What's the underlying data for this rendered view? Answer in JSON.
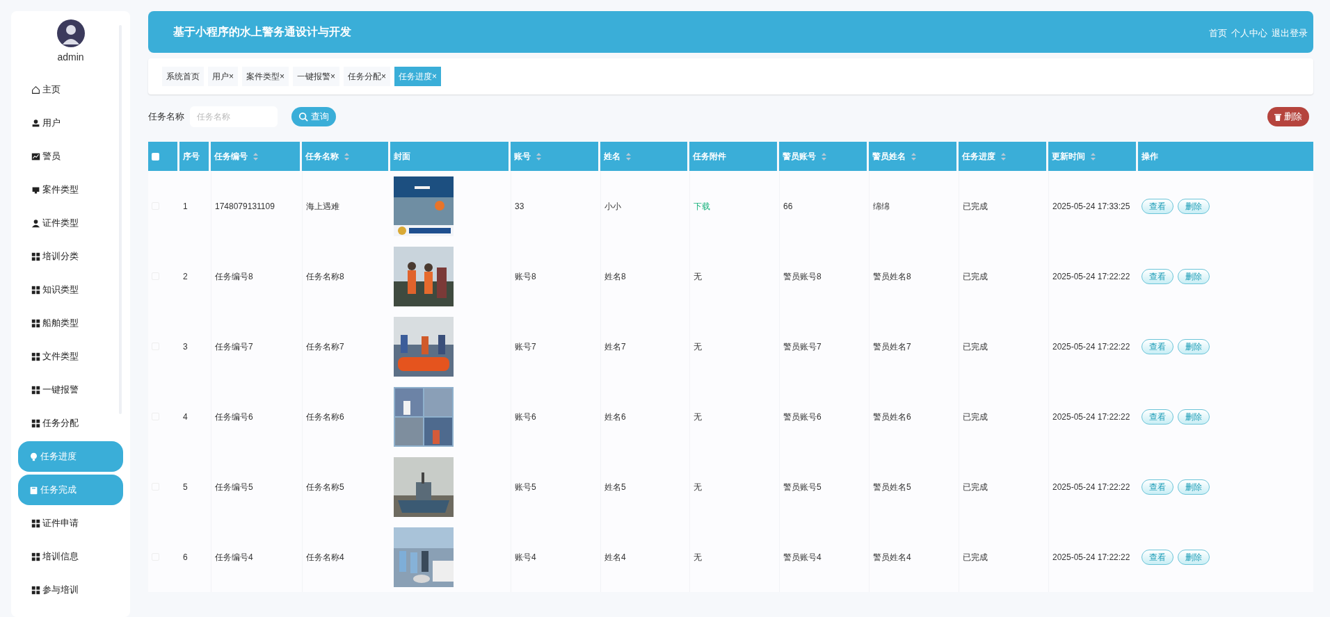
{
  "sidebar": {
    "user": "admin",
    "items": [
      {
        "label": "主页",
        "kind": "home",
        "selected": false
      },
      {
        "label": "用户",
        "kind": "user",
        "selected": false
      },
      {
        "label": "警员",
        "kind": "chart",
        "selected": false
      },
      {
        "label": "案件类型",
        "kind": "tray",
        "selected": false
      },
      {
        "label": "证件类型",
        "kind": "person",
        "selected": false
      },
      {
        "label": "培训分类",
        "kind": "grid",
        "selected": false
      },
      {
        "label": "知识类型",
        "kind": "grid",
        "selected": false
      },
      {
        "label": "船舶类型",
        "kind": "grid",
        "selected": false
      },
      {
        "label": "文件类型",
        "kind": "grid",
        "selected": false
      },
      {
        "label": "一键报警",
        "kind": "grid",
        "selected": false
      },
      {
        "label": "任务分配",
        "kind": "grid",
        "selected": false
      },
      {
        "label": "任务进度",
        "kind": "bulb",
        "selected": true
      },
      {
        "label": "任务完成",
        "kind": "clipboard",
        "selected": true
      },
      {
        "label": "证件申请",
        "kind": "grid",
        "selected": false
      },
      {
        "label": "培训信息",
        "kind": "grid",
        "selected": false
      },
      {
        "label": "参与培训",
        "kind": "grid",
        "selected": false
      }
    ]
  },
  "header": {
    "title": "基于小程序的水上警务通设计与开发",
    "links": [
      "首页",
      "个人中心",
      "退出登录"
    ]
  },
  "tabs": [
    {
      "label": "系统首页",
      "selected": false
    },
    {
      "label": "用户",
      "close": "×",
      "selected": false
    },
    {
      "label": "案件类型",
      "close": "×",
      "selected": false
    },
    {
      "label": "一键报警",
      "close": "×",
      "selected": false
    },
    {
      "label": "任务分配",
      "close": "×",
      "selected": false
    },
    {
      "label": "任务进度",
      "close": "×",
      "selected": true
    }
  ],
  "search": {
    "label": "任务名称",
    "placeholder": "任务名称",
    "button": "查询"
  },
  "delete_button": "删除",
  "table": {
    "all_checked": false,
    "columns": [
      {
        "label": "序号",
        "sortable": false
      },
      {
        "label": "任务编号",
        "sortable": true
      },
      {
        "label": "任务名称",
        "sortable": true
      },
      {
        "label": "封面",
        "sortable": false
      },
      {
        "label": "账号",
        "sortable": true
      },
      {
        "label": "姓名",
        "sortable": true
      },
      {
        "label": "任务附件",
        "sortable": false
      },
      {
        "label": "警员账号",
        "sortable": true
      },
      {
        "label": "警员姓名",
        "sortable": true
      },
      {
        "label": "任务进度",
        "sortable": true
      },
      {
        "label": "更新时间",
        "sortable": true
      },
      {
        "label": "操作",
        "sortable": false
      }
    ],
    "rows": [
      {
        "checked": false,
        "index": "1",
        "task_no": "1748079131109",
        "task_name": "海上遇难",
        "account": "33",
        "name": "小小",
        "attachment": {
          "text": "下载",
          "kind": "link"
        },
        "officer_account": "66",
        "officer_name": "绵绵",
        "progress": "已完成",
        "updated": "2025-05-24 17:33:25",
        "actions": [
          "查看",
          "删除"
        ]
      },
      {
        "checked": false,
        "index": "2",
        "task_no": "任务编号8",
        "task_name": "任务名称8",
        "account": "账号8",
        "name": "姓名8",
        "attachment": {
          "text": "无",
          "kind": "text"
        },
        "officer_account": "警员账号8",
        "officer_name": "警员姓名8",
        "progress": "已完成",
        "updated": "2025-05-24 17:22:22",
        "actions": [
          "查看",
          "删除"
        ]
      },
      {
        "checked": false,
        "index": "3",
        "task_no": "任务编号7",
        "task_name": "任务名称7",
        "account": "账号7",
        "name": "姓名7",
        "attachment": {
          "text": "无",
          "kind": "text"
        },
        "officer_account": "警员账号7",
        "officer_name": "警员姓名7",
        "progress": "已完成",
        "updated": "2025-05-24 17:22:22",
        "actions": [
          "查看",
          "删除"
        ]
      },
      {
        "checked": false,
        "index": "4",
        "task_no": "任务编号6",
        "task_name": "任务名称6",
        "account": "账号6",
        "name": "姓名6",
        "attachment": {
          "text": "无",
          "kind": "text"
        },
        "officer_account": "警员账号6",
        "officer_name": "警员姓名6",
        "progress": "已完成",
        "updated": "2025-05-24 17:22:22",
        "actions": [
          "查看",
          "删除"
        ]
      },
      {
        "checked": false,
        "index": "5",
        "task_no": "任务编号5",
        "task_name": "任务名称5",
        "account": "账号5",
        "name": "姓名5",
        "attachment": {
          "text": "无",
          "kind": "text"
        },
        "officer_account": "警员账号5",
        "officer_name": "警员姓名5",
        "progress": "已完成",
        "updated": "2025-05-24 17:22:22",
        "actions": [
          "查看",
          "删除"
        ]
      },
      {
        "checked": false,
        "index": "6",
        "task_no": "任务编号4",
        "task_name": "任务名称4",
        "account": "账号4",
        "name": "姓名4",
        "attachment": {
          "text": "无",
          "kind": "text"
        },
        "officer_account": "警员账号4",
        "officer_name": "警员姓名4",
        "progress": "已完成",
        "updated": "2025-05-24 17:22:22",
        "actions": [
          "查看",
          "删除"
        ]
      }
    ]
  }
}
